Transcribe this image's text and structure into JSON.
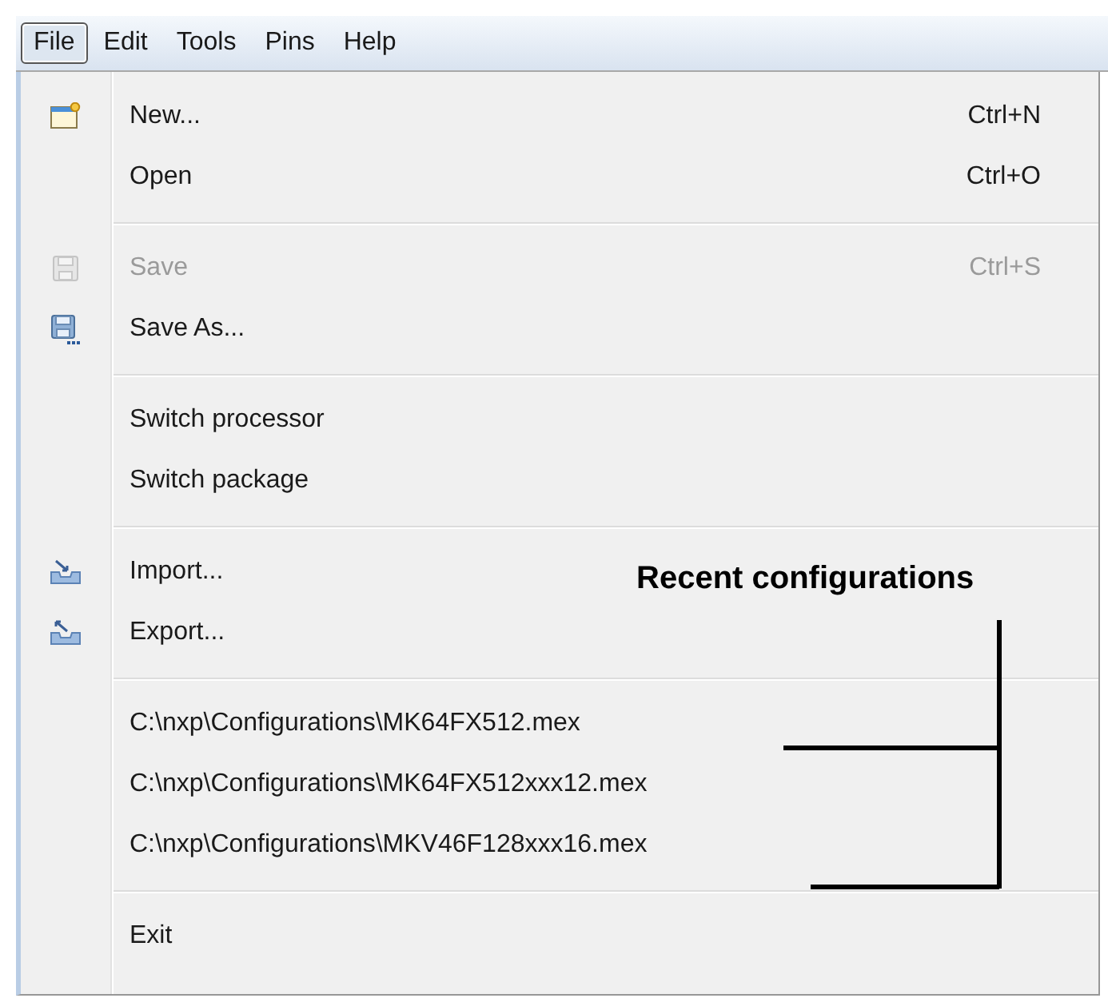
{
  "menubar": [
    {
      "label": "File",
      "selected": true
    },
    {
      "label": "Edit",
      "selected": false
    },
    {
      "label": "Tools",
      "selected": false
    },
    {
      "label": "Pins",
      "selected": false
    },
    {
      "label": "Help",
      "selected": false
    }
  ],
  "menu": {
    "groups": [
      [
        {
          "kind": "window",
          "label": "New...",
          "shortcut": "Ctrl+N",
          "disabled": false
        },
        {
          "kind": "plain",
          "label": "Open",
          "shortcut": "Ctrl+O",
          "disabled": false
        }
      ],
      [
        {
          "kind": "disk",
          "label": "Save",
          "shortcut": "Ctrl+S",
          "disabled": true
        },
        {
          "kind": "disk-more",
          "label": "Save As...",
          "disabled": false
        }
      ],
      [
        {
          "kind": "plain",
          "label": "Switch processor",
          "disabled": false
        },
        {
          "kind": "plain",
          "label": "Switch package",
          "disabled": false
        }
      ],
      [
        {
          "kind": "tray-in",
          "label": "Import...",
          "disabled": false
        },
        {
          "kind": "tray-out",
          "label": "Export...",
          "disabled": false
        }
      ],
      [
        {
          "kind": "plain",
          "label": "C:\\nxp\\Configurations\\MK64FX512.mex",
          "disabled": false
        },
        {
          "kind": "plain",
          "label": "C:\\nxp\\Configurations\\MK64FX512xxx12.mex",
          "disabled": false
        },
        {
          "kind": "plain",
          "label": "C:\\nxp\\Configurations\\MKV46F128xxx16.mex",
          "disabled": false
        }
      ],
      [
        {
          "kind": "plain",
          "label": "Exit",
          "disabled": false
        }
      ]
    ]
  },
  "annotation": {
    "label": "Recent configurations"
  }
}
